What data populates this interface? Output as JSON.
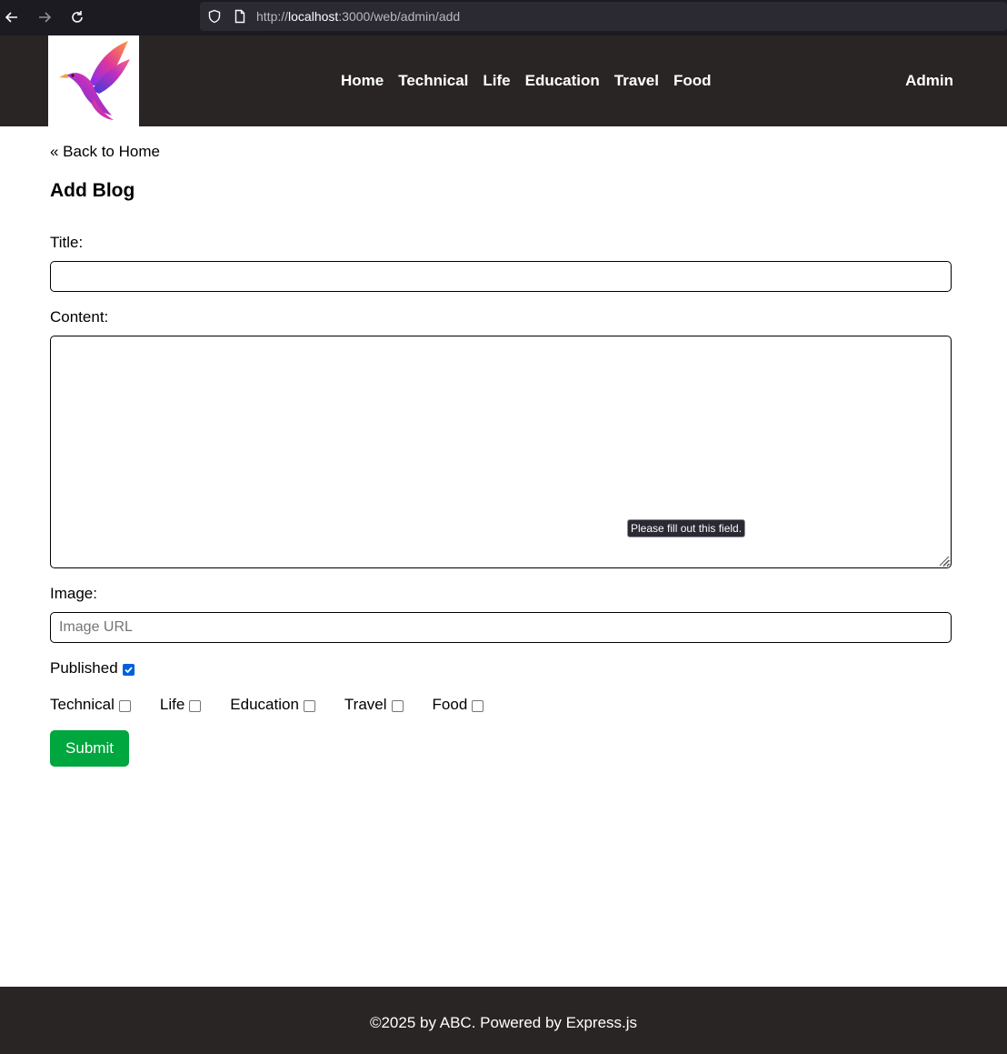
{
  "browser": {
    "url_prefix": "http://",
    "url_host": "localhost",
    "url_path": ":3000/web/admin/add"
  },
  "header": {
    "nav_items": [
      "Home",
      "Technical",
      "Life",
      "Education",
      "Travel",
      "Food"
    ],
    "admin_label": "Admin"
  },
  "page": {
    "back_link": "« Back to Home",
    "title": "Add Blog"
  },
  "form": {
    "title_label": "Title:",
    "title_value": "",
    "content_label": "Content:",
    "content_value": "",
    "validation_tooltip": "Please fill out this field.",
    "image_label": "Image:",
    "image_placeholder": "Image URL",
    "published_label": "Published",
    "published_checked": true,
    "categories": [
      {
        "label": "Technical",
        "checked": false
      },
      {
        "label": "Life",
        "checked": false
      },
      {
        "label": "Education",
        "checked": false
      },
      {
        "label": "Travel",
        "checked": false
      },
      {
        "label": "Food",
        "checked": false
      }
    ],
    "submit_label": "Submit"
  },
  "footer": {
    "text": "©2025 by ABC. Powered by Express.js"
  },
  "colors": {
    "header_bg": "#292524",
    "submit_bg": "#00a63e",
    "checkbox_checked": "#0060df"
  }
}
